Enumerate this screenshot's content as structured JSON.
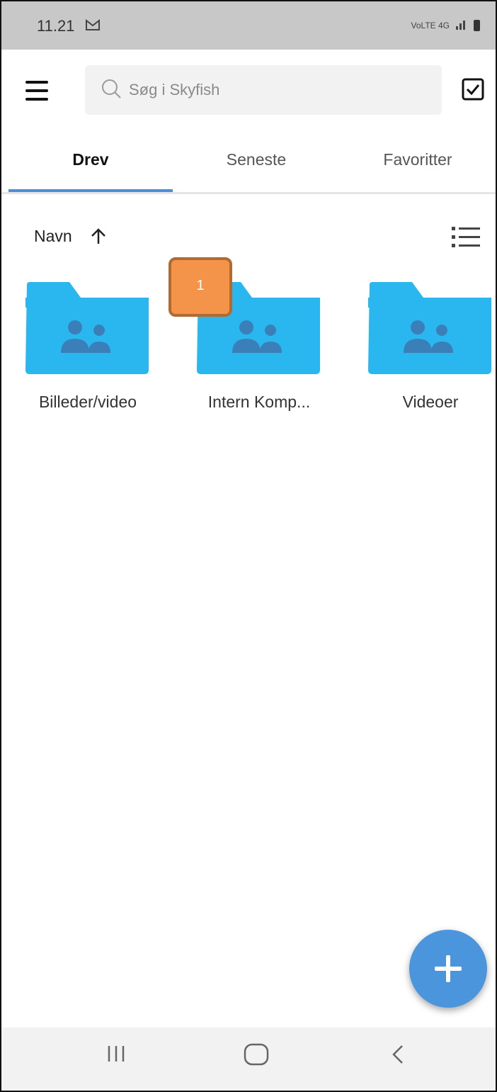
{
  "status_bar": {
    "time": "11.21",
    "notification_icon": "gmail-icon",
    "network_text": "VoLTE 4G"
  },
  "search": {
    "placeholder": "Søg i Skyfish"
  },
  "tabs": [
    {
      "label": "Drev",
      "active": true
    },
    {
      "label": "Seneste",
      "active": false
    },
    {
      "label": "Favoritter",
      "active": false
    }
  ],
  "sort": {
    "label": "Navn",
    "direction": "ascending"
  },
  "folders": [
    {
      "label": "Billeder/video",
      "icon": "shared-folder-icon"
    },
    {
      "label": "Intern Komp...",
      "icon": "shared-folder-icon"
    },
    {
      "label": "Videoer",
      "icon": "shared-folder-icon"
    }
  ],
  "annotation": {
    "badge_text": "1"
  },
  "colors": {
    "accent": "#4a8fd8",
    "folder": "#2ab7f0",
    "badge": "#f4934a",
    "fab": "#4a95dc"
  }
}
